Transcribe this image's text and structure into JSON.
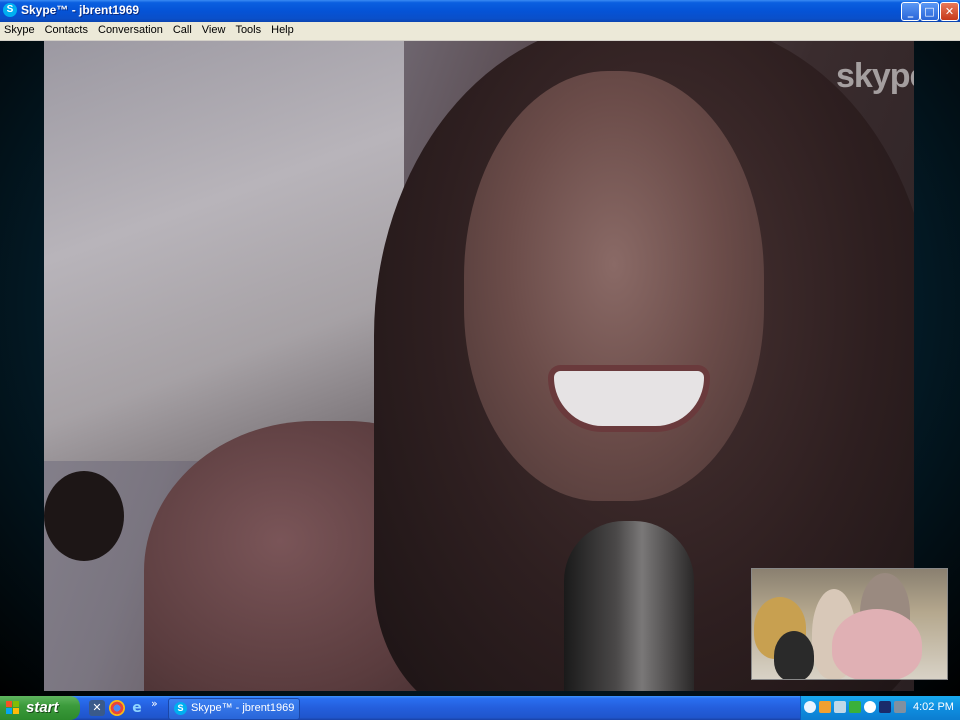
{
  "window": {
    "icon_letter": "S",
    "title": "Skype™ - jbrent1969",
    "minimize_glyph": "_",
    "maximize_glyph": "□",
    "close_glyph": "✕"
  },
  "menu": [
    "Skype",
    "Contacts",
    "Conversation",
    "Call",
    "View",
    "Tools",
    "Help"
  ],
  "video": {
    "watermark": "skype"
  },
  "taskbar": {
    "start_label": "start",
    "more_glyph": "»",
    "task_title": "Skype™ - jbrent1969",
    "clock": "4:02 PM",
    "quick_launch_icons": [
      "desktop-icon",
      "chrome-icon",
      "internet-explorer-icon"
    ],
    "tray_icons": [
      "back-arrow-icon",
      "mail-icon",
      "network-icon",
      "security-icon",
      "skype-status-icon",
      "volume-icon",
      "updates-icon"
    ]
  },
  "colors": {
    "titlebar": "#0553d6",
    "taskbar": "#245edc",
    "start": "#3c9b3c",
    "skype_blue": "#00aff0",
    "menubar": "#ece9d8"
  }
}
